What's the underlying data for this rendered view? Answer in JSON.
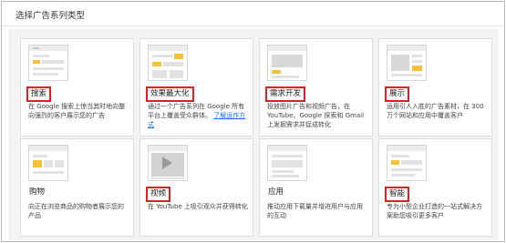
{
  "header": {
    "title": "选择广告系列类型"
  },
  "cards": [
    {
      "name": "搜索",
      "desc": "在 Google 搜索上惊当其时地向整向强烈的客户展示您的广告",
      "link": ""
    },
    {
      "name": "效果最大化",
      "desc": "通过一个广告系列在 Google 所有平台上覆盖受众群体。",
      "link": "了解运作方式"
    },
    {
      "name": "需求开发",
      "desc": "投放图片广告和视频广告，在 YouTube、Google 探索和 Gmail 上发掘需求并促成转化",
      "link": ""
    },
    {
      "name": "展示",
      "desc": "运用引人入胜的广告素材，在 300 万个网站和应用中覆盖客户",
      "link": ""
    },
    {
      "name": "购物",
      "desc": "向正在浏览商品的购物者展示您的产品",
      "link": ""
    },
    {
      "name": "视频",
      "desc": "在 YouTube 上吸引观众并获得转化",
      "link": ""
    },
    {
      "name": "应用",
      "desc": "推动应用下载量并增进用户与应用的互动",
      "link": ""
    },
    {
      "name": "智能",
      "desc": "专为小型企业打造的一站式解决方案助您吸引更多客户",
      "link": ""
    }
  ],
  "colors": {
    "highlight": "#e02020",
    "accent": "#f6c23e",
    "link": "#1a73e8"
  }
}
